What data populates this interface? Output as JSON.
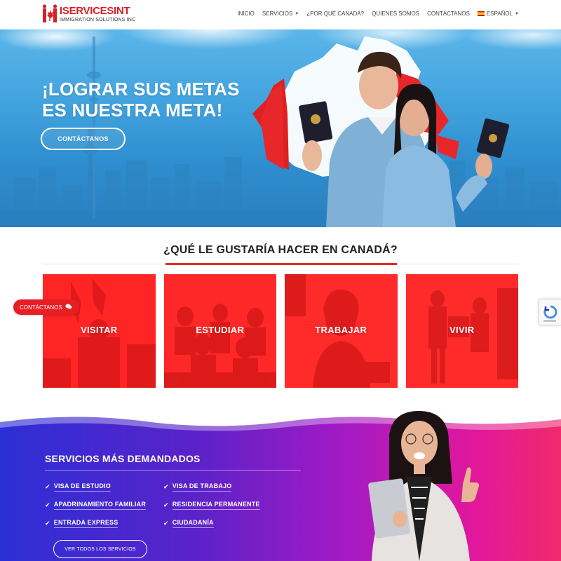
{
  "header": {
    "logo_brand": "ISERVICESINT",
    "logo_sub": "IMMIGRATION SOLUTIONS INC",
    "nav": [
      {
        "label": "INICIO"
      },
      {
        "label": "SERVICIOS"
      },
      {
        "label": "¿POR QUÉ CANADÁ?"
      },
      {
        "label": "QUIENES SOMOS"
      },
      {
        "label": "CONTÁCTANOS"
      },
      {
        "label": "ESPAÑOL"
      }
    ]
  },
  "hero": {
    "title_line1": "¡LOGRAR SUS METAS",
    "title_line2": "ES NUESTRA META!",
    "cta_label": "CONTÁCTANOS"
  },
  "section": {
    "title": "¿QUÉ LE GUSTARÍA HACER EN CANADÁ?"
  },
  "cards": [
    {
      "label": "VISITAR"
    },
    {
      "label": "ESTUDIAR"
    },
    {
      "label": "TRABAJAR"
    },
    {
      "label": "VIVIR"
    }
  ],
  "floating_contact": {
    "label": "CONTÁCTANOS"
  },
  "services": {
    "title": "SERVICIOS MÁS DEMANDADOS",
    "items": [
      {
        "label": "VISA DE ESTUDIO"
      },
      {
        "label": "VISA DE TRABAJO"
      },
      {
        "label": "APADRINAMIENTO FAMILIAR"
      },
      {
        "label": "RESIDENCIA PERMANENTE"
      },
      {
        "label": "ENTRADA EXPRESS"
      },
      {
        "label": "CIUDADANÍA"
      }
    ],
    "button_label": "VER TODOS LOS SERVICIOS"
  },
  "colors": {
    "brand_red": "#d91f26",
    "accent_red": "#e02a2a",
    "hero_blue": "#3fa1dc",
    "services_gradient_start": "#2c2fd6",
    "services_gradient_end": "#f02a6c"
  }
}
